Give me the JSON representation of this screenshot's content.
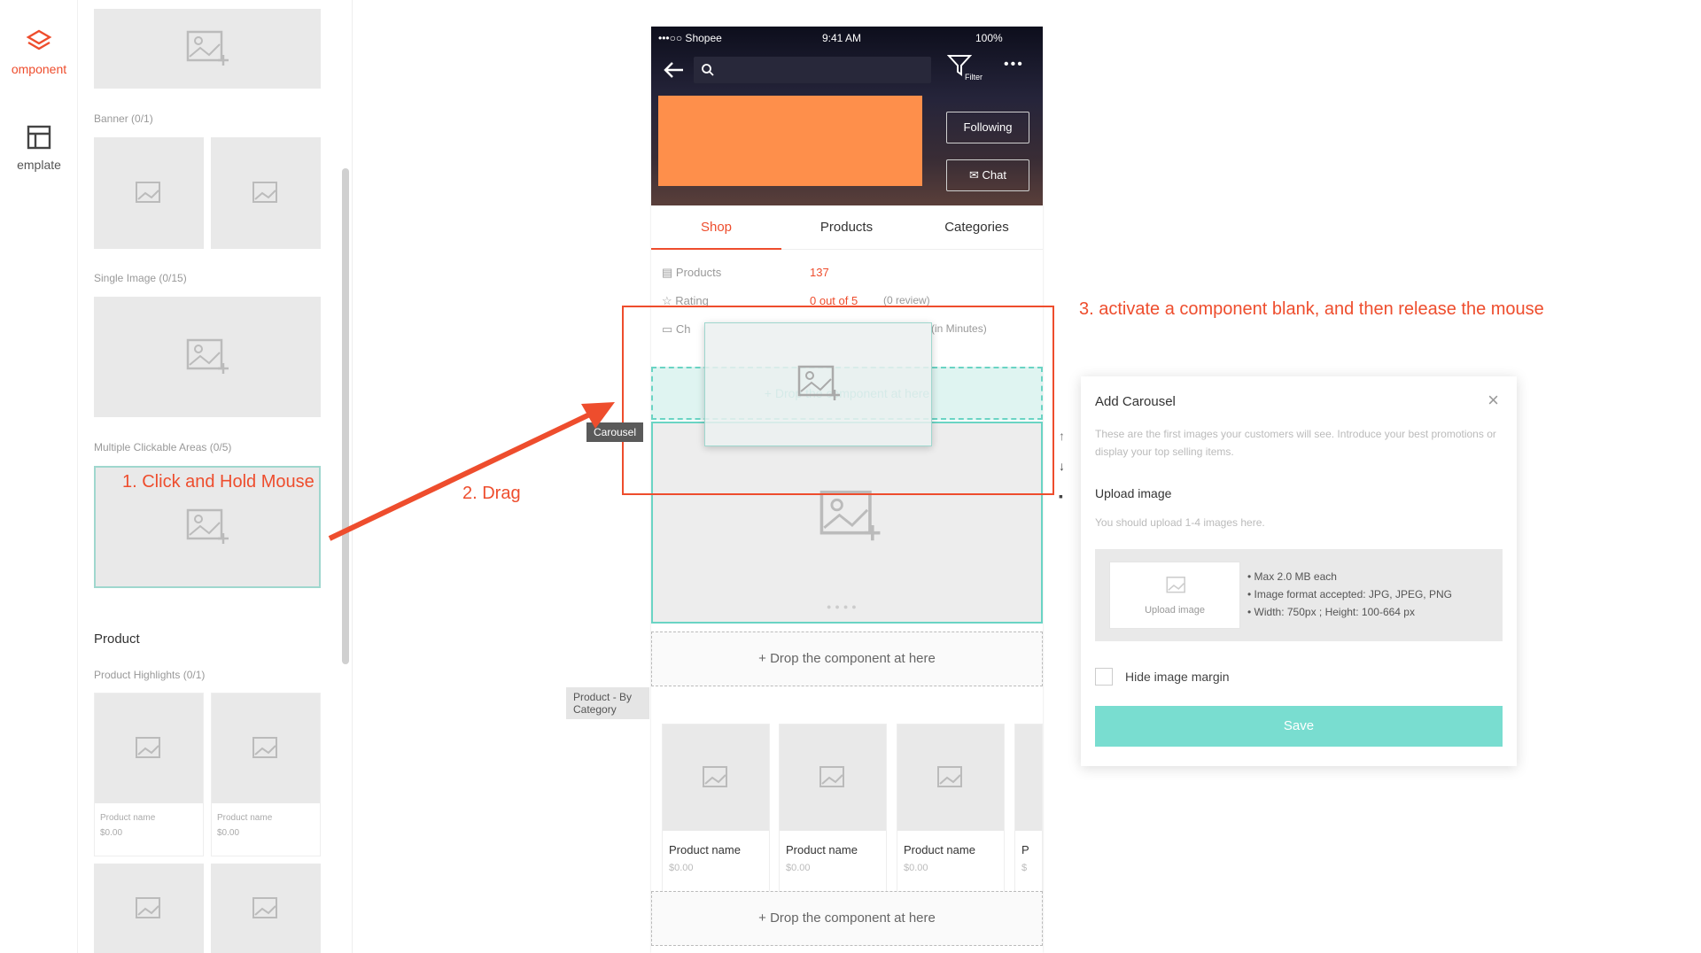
{
  "rail": {
    "items": [
      {
        "label": "omponent",
        "icon": "layers-icon",
        "active": true
      },
      {
        "label": "emplate",
        "icon": "template-icon",
        "active": false
      }
    ]
  },
  "panel": {
    "banner_label": "Banner (0/1)",
    "single_image_label": "Single Image (0/15)",
    "clickable_label": "Multiple Clickable Areas (0/5)",
    "product_title": "Product",
    "highlights_label": "Product Highlights (0/1)",
    "tile_product_name": "Product name",
    "tile_product_price": "$0.00"
  },
  "phone": {
    "status": {
      "carrier": "•••○○ Shopee",
      "time": "9:41 AM",
      "battery": "100%"
    },
    "filter_label": "Filter",
    "following_label": "Following",
    "chat_label": "Chat",
    "tabs": [
      "Shop",
      "Products",
      "Categories"
    ],
    "info": {
      "products_label": "Products",
      "products_value": "137",
      "rating_label": "Rating",
      "rating_value": "0 out of 5",
      "rating_reviews": "(0 review)",
      "chat_label": "Ch",
      "chat_value": "(in Minutes)"
    },
    "drop_text": "Drop the component at here",
    "products": [
      {
        "name": "Product name",
        "price": "$0.00"
      },
      {
        "name": "Product name",
        "price": "$0.00"
      },
      {
        "name": "Product name",
        "price": "$0.00"
      },
      {
        "name": "P",
        "price": "$"
      }
    ]
  },
  "tags": {
    "carousel": "Carousel",
    "product_by_category": "Product - By Category"
  },
  "annotations": {
    "step1": "1. Click and Hold Mouse",
    "step2": "2. Drag",
    "step3": "3. activate a component blank, and then release the mouse"
  },
  "dialog": {
    "title": "Add Carousel",
    "description": "These are the first images your customers will see. Introduce your best promotions or display your top selling items.",
    "upload_title": "Upload image",
    "upload_hint": "You should upload 1-4 images here.",
    "upload_button": "Upload image",
    "requirements": [
      "• Max 2.0 MB each",
      "• Image format accepted: JPG, JPEG, PNG",
      "• Width: 750px ; Height: 100-664 px"
    ],
    "hide_margin_label": "Hide image margin",
    "save_label": "Save"
  },
  "colors": {
    "accent": "#ee4d2d",
    "teal": "#6ad4c4",
    "orange_block": "#fe8f4b"
  }
}
